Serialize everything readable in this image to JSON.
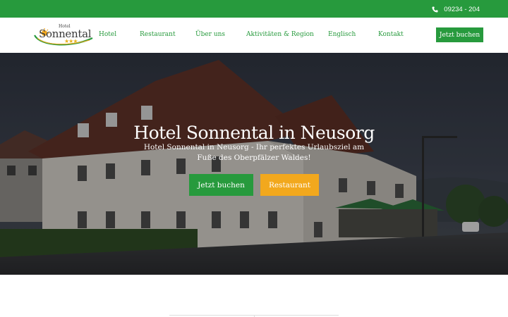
{
  "topbar": {
    "phone_icon": "phone-icon",
    "phone": "09234 - 204",
    "color": "#279a3d"
  },
  "logo": {
    "small": "Hotel",
    "main": "Sonnental",
    "stars": "★★★"
  },
  "nav": {
    "items": [
      {
        "label": "Hotel"
      },
      {
        "label": "Restaurant"
      },
      {
        "label": "Über uns"
      },
      {
        "label": "Aktivitäten & Region"
      },
      {
        "label": "Englisch"
      },
      {
        "label": "Kontakt"
      }
    ],
    "cta": "Jetzt buchen"
  },
  "hero": {
    "title": "Hotel Sonnental in Neusorg",
    "subtitle": "Hotel Sonnental in Neusorg - Ihr perfektes Urlaubsziel am Fuße des Oberpfälzer Waldes!",
    "book_button": "Jetzt buchen",
    "restaurant_button": "Restaurant"
  },
  "colors": {
    "green": "#279a3d",
    "orange": "#f2a81d",
    "star": "#e8b21a"
  }
}
